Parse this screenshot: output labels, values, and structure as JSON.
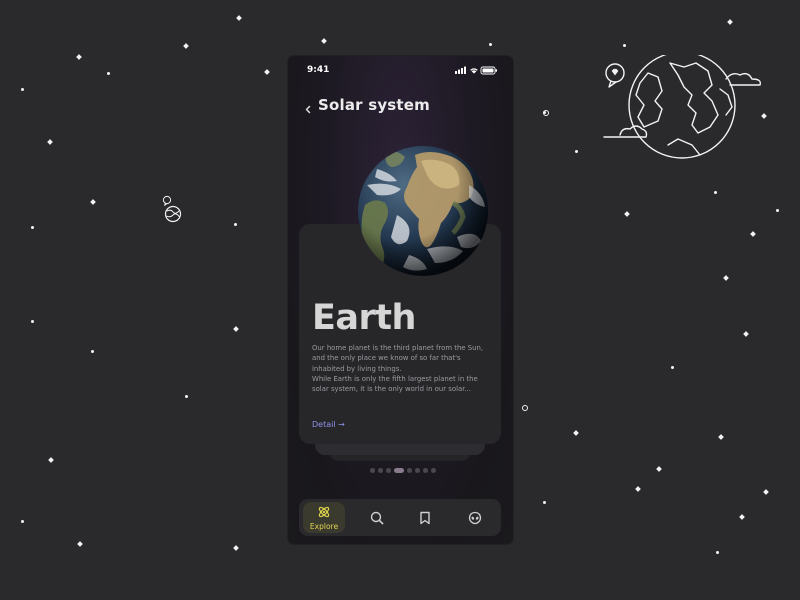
{
  "status_bar": {
    "time": "9:41"
  },
  "header": {
    "title": "Solar system",
    "back_icon": "chevron-left-icon"
  },
  "card": {
    "planet_name": "Earth",
    "description_1": "Our home planet is the third planet from the Sun, and the only place we know of so far that's inhabited by living things.",
    "description_2": "While Earth is only the fifth largest planet in the solar system, it is the only world in our solar...",
    "detail_label": "Detail →"
  },
  "pager": {
    "count": 9,
    "active_index": 3
  },
  "tab_bar": {
    "tabs": [
      {
        "label": "Explore",
        "icon": "atom-icon",
        "active": true
      },
      {
        "label": "",
        "icon": "search-icon",
        "active": false
      },
      {
        "label": "",
        "icon": "bookmark-icon",
        "active": false
      },
      {
        "label": "",
        "icon": "alien-icon",
        "active": false
      }
    ]
  },
  "colors": {
    "background": "#2a292b",
    "accent_yellow": "#e3d44f",
    "link_purple": "#8f92ea",
    "card": "#272629"
  }
}
